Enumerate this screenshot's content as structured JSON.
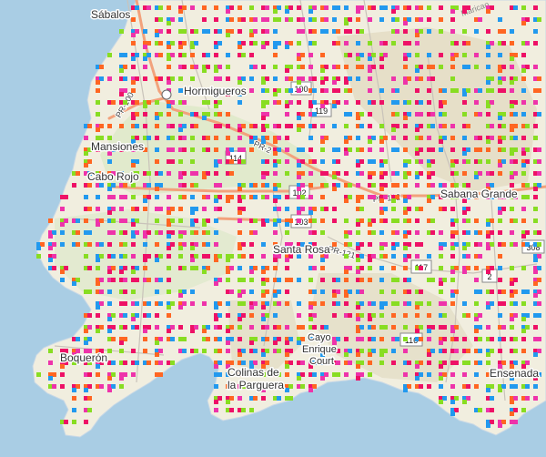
{
  "map": {
    "colors": {
      "water": "#a9cde4",
      "land": "#f1eedf",
      "land_green": "#dbe8c6",
      "hills": "#e4ddc5",
      "major_road": "#f2a27c",
      "minor_road": "#c9c3ba",
      "marker_palette": [
        "#ee1166",
        "#2299ee",
        "#ff6622",
        "#88dd22",
        "#ee33aa"
      ]
    },
    "places": [
      {
        "name": "Sábalos"
      },
      {
        "name": "Hormigueros"
      },
      {
        "name": "Mansiones"
      },
      {
        "name": "Cabo Rojo"
      },
      {
        "name": "Santa Rosa"
      },
      {
        "name": "Sabana Grande"
      },
      {
        "name": "Boquerón"
      },
      {
        "name": "Cayo"
      },
      {
        "name": "Enrique"
      },
      {
        "name": "Court"
      },
      {
        "name": "Colinas de"
      },
      {
        "name": "la Parguera"
      },
      {
        "name": "Ensenada"
      }
    ],
    "route_shields": [
      "114",
      "119",
      "102",
      "103",
      "117",
      "308",
      "2",
      "116",
      "100"
    ],
    "road_labels": [
      "PR-100",
      "PR-2",
      "PR-102",
      "PR-121"
    ],
    "faint_labels": [
      "Maricao"
    ],
    "marker_density": "dense grid of small colored squares across land area"
  }
}
